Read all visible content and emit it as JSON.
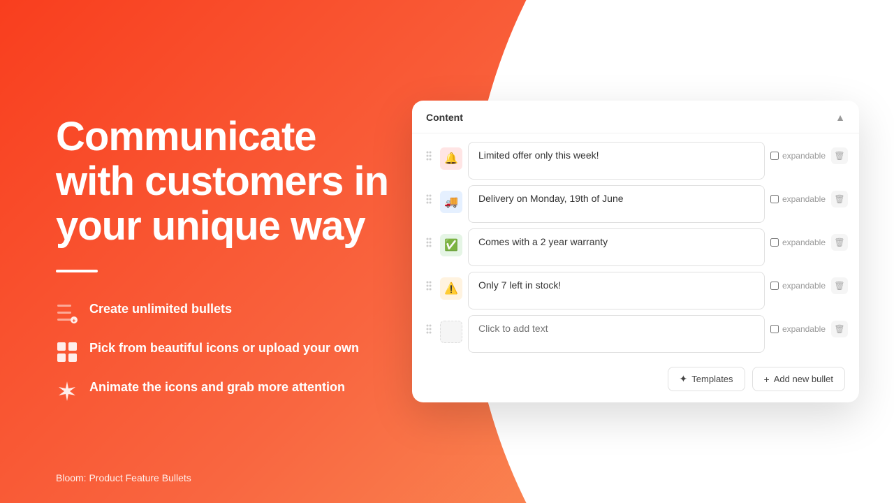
{
  "background": {
    "colors": {
      "orange_start": "#f93e1e",
      "orange_end": "#faa060"
    }
  },
  "hero": {
    "title": "Communicate with customers in your unique way",
    "divider": true,
    "features": [
      {
        "id": "unlimited-bullets",
        "icon": "bullets-icon",
        "text": "Create unlimited bullets"
      },
      {
        "id": "icons",
        "icon": "grid-icon",
        "text": "Pick from beautiful icons or upload your own"
      },
      {
        "id": "animate",
        "icon": "sparkle-icon",
        "text": "Animate the icons and grab more attention"
      }
    ]
  },
  "bottom_label": "Bloom: Product Feature Bullets",
  "panel": {
    "title": "Content",
    "collapse_label": "▲",
    "bullets": [
      {
        "id": 1,
        "icon_type": "red",
        "icon_emoji": "🔔",
        "text": "Limited offer only this week!",
        "expandable": false,
        "placeholder": false
      },
      {
        "id": 2,
        "icon_type": "blue",
        "icon_emoji": "🚚",
        "text": "Delivery on Monday, 19th of June",
        "expandable": false,
        "placeholder": false
      },
      {
        "id": 3,
        "icon_type": "green",
        "icon_emoji": "✅",
        "text": "Comes with a 2 year warranty",
        "expandable": false,
        "placeholder": false
      },
      {
        "id": 4,
        "icon_type": "orange",
        "icon_emoji": "⚠️",
        "text": "Only 7 left in stock!",
        "expandable": false,
        "placeholder": false
      },
      {
        "id": 5,
        "icon_type": "empty",
        "icon_emoji": "",
        "text": "",
        "placeholder_text": "Click to add text",
        "expandable": false,
        "placeholder": true
      }
    ],
    "expandable_label": "expandable",
    "footer": {
      "templates_btn": "✦ Templates",
      "add_bullet_btn": "+ Add new bullet"
    }
  }
}
